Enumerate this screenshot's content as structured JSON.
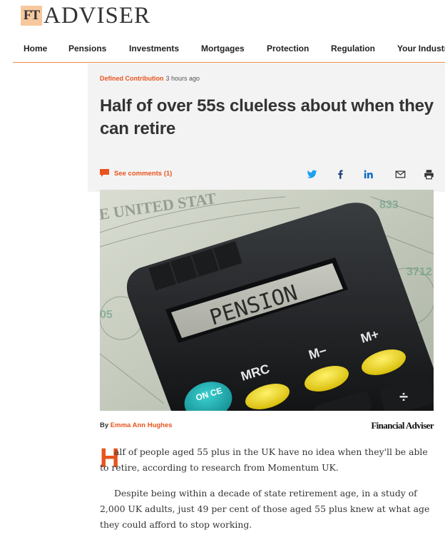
{
  "site": {
    "logo_mark": "FT",
    "logo_text": "ADVISER"
  },
  "nav": {
    "items": [
      "Home",
      "Pensions",
      "Investments",
      "Mortgages",
      "Protection",
      "Regulation",
      "Your Industry"
    ]
  },
  "article": {
    "category": "Defined Contribution",
    "time_ago": "3 hours ago",
    "headline": "Half of over 55s clueless about when they can retire",
    "comments_label": "See comments (1)",
    "share_icons": [
      "twitter-icon",
      "facebook-icon",
      "linkedin-icon",
      "email-icon",
      "print-icon"
    ],
    "image": {
      "calculator_display": "PENSION",
      "keys": [
        "MRC",
        "M−",
        "M+",
        "ON CE"
      ]
    },
    "byline_prefix": "By",
    "author": "Emma Ann Hughes",
    "source_logo": "Financial Adviser",
    "dropcap": "H",
    "paragraph1": "alf of people aged 55 plus in the UK have no idea when they'll be able to retire, according to research from Momentum UK.",
    "paragraph2": "Despite being within a decade of state retirement age, in a study of 2,000 UK adults, just 49 per cent of those aged 55 plus knew at what age they could afford to stop working."
  },
  "colors": {
    "accent": "#e8541f",
    "twitter": "#1da1f2",
    "linkedin": "#0a66c2",
    "logo_mark_bg": "#f7c89d"
  }
}
